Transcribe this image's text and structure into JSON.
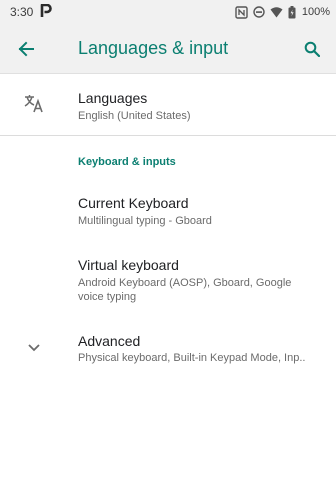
{
  "status_bar": {
    "time": "3:30",
    "battery": "100%",
    "icons": [
      "p-notification-icon",
      "nfc-icon",
      "do-not-disturb-icon",
      "wifi-icon",
      "battery-icon"
    ]
  },
  "toolbar": {
    "title": "Languages & input",
    "back_icon": "arrow-back-icon",
    "search_icon": "search-icon"
  },
  "items": {
    "languages": {
      "title": "Languages",
      "summary": "English (United States)",
      "icon": "translate-icon"
    },
    "section_header": "Keyboard & inputs",
    "current_keyboard": {
      "title": "Current Keyboard",
      "summary": "Multilingual typing - Gboard"
    },
    "virtual_keyboard": {
      "title": "Virtual keyboard",
      "summary": "Android Keyboard (AOSP), Gboard, Google voice typing"
    },
    "advanced": {
      "title": "Advanced",
      "summary": "Physical keyboard, Built-in Keypad Mode, Inp..",
      "icon": "chevron-down-icon"
    }
  },
  "colors": {
    "accent": "#0b7f71",
    "toolbar_bg": "#f1f1f1",
    "text_primary": "#202124",
    "text_secondary": "#6b6b6b"
  }
}
